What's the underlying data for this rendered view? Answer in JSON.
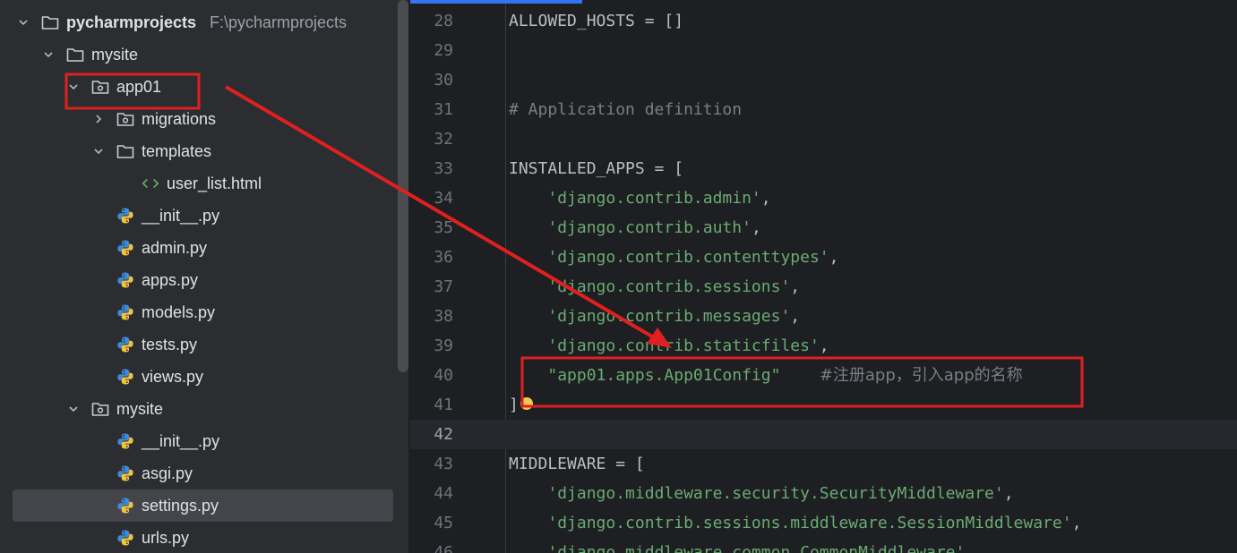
{
  "project_tree": {
    "rows": [
      {
        "label": "pycharmprojects",
        "path": "F:\\pycharmprojects",
        "type": "folder",
        "expanded": true,
        "bold": true,
        "depth": 0
      },
      {
        "label": "mysite",
        "type": "folder",
        "expanded": true,
        "depth": 1
      },
      {
        "label": "app01",
        "type": "package",
        "expanded": true,
        "depth": 2
      },
      {
        "label": "migrations",
        "type": "package",
        "expanded": false,
        "depth": 3
      },
      {
        "label": "templates",
        "type": "folder",
        "expanded": true,
        "depth": 3
      },
      {
        "label": "user_list.html",
        "type": "html",
        "depth": 4
      },
      {
        "label": "__init__.py",
        "type": "python",
        "depth": 3
      },
      {
        "label": "admin.py",
        "type": "python",
        "depth": 3
      },
      {
        "label": "apps.py",
        "type": "python",
        "depth": 3
      },
      {
        "label": "models.py",
        "type": "python",
        "depth": 3
      },
      {
        "label": "tests.py",
        "type": "python",
        "depth": 3
      },
      {
        "label": "views.py",
        "type": "python",
        "depth": 3
      },
      {
        "label": "mysite",
        "type": "package",
        "expanded": true,
        "depth": 2
      },
      {
        "label": "__init__.py",
        "type": "python",
        "depth": 3
      },
      {
        "label": "asgi.py",
        "type": "python",
        "depth": 3
      },
      {
        "label": "settings.py",
        "type": "python",
        "depth": 3,
        "selected": true
      },
      {
        "label": "urls.py",
        "type": "python",
        "depth": 3
      }
    ]
  },
  "editor": {
    "current_line": "42",
    "lines": [
      {
        "n": "28",
        "parts": [
          {
            "t": "ALLOWED_HOSTS = []",
            "c": "plain"
          }
        ]
      },
      {
        "n": "29",
        "parts": []
      },
      {
        "n": "30",
        "parts": []
      },
      {
        "n": "31",
        "parts": [
          {
            "t": "# Application definition",
            "c": "cmt"
          }
        ]
      },
      {
        "n": "32",
        "parts": []
      },
      {
        "n": "33",
        "parts": [
          {
            "t": "INSTALLED_APPS = [",
            "c": "plain"
          }
        ]
      },
      {
        "n": "34",
        "parts": [
          {
            "t": "    ",
            "c": "plain"
          },
          {
            "t": "'django.contrib.admin'",
            "c": "str"
          },
          {
            "t": ",",
            "c": "plain"
          }
        ]
      },
      {
        "n": "35",
        "parts": [
          {
            "t": "    ",
            "c": "plain"
          },
          {
            "t": "'django.contrib.auth'",
            "c": "str"
          },
          {
            "t": ",",
            "c": "plain"
          }
        ]
      },
      {
        "n": "36",
        "parts": [
          {
            "t": "    ",
            "c": "plain"
          },
          {
            "t": "'django.contrib.contenttypes'",
            "c": "str"
          },
          {
            "t": ",",
            "c": "plain"
          }
        ]
      },
      {
        "n": "37",
        "parts": [
          {
            "t": "    ",
            "c": "plain"
          },
          {
            "t": "'django.contrib.sessions'",
            "c": "str"
          },
          {
            "t": ",",
            "c": "plain"
          }
        ]
      },
      {
        "n": "38",
        "parts": [
          {
            "t": "    ",
            "c": "plain"
          },
          {
            "t": "'django.contrib.messages'",
            "c": "str"
          },
          {
            "t": ",",
            "c": "plain"
          }
        ]
      },
      {
        "n": "39",
        "parts": [
          {
            "t": "    ",
            "c": "plain"
          },
          {
            "t": "'django.contrib.staticfiles'",
            "c": "str"
          },
          {
            "t": ",",
            "c": "plain"
          }
        ]
      },
      {
        "n": "40",
        "parts": [
          {
            "t": "    ",
            "c": "plain"
          },
          {
            "t": "\"app01.apps.App01Config\"",
            "c": "str"
          },
          {
            "t": "    ",
            "c": "plain"
          },
          {
            "t": "#注册app，引入app的名称",
            "c": "zh"
          }
        ]
      },
      {
        "n": "41",
        "parts": [
          {
            "t": "]",
            "c": "plain"
          }
        ]
      },
      {
        "n": "42",
        "parts": []
      },
      {
        "n": "43",
        "parts": [
          {
            "t": "MIDDLEWARE = [",
            "c": "plain"
          }
        ]
      },
      {
        "n": "44",
        "parts": [
          {
            "t": "    ",
            "c": "plain"
          },
          {
            "t": "'django.middleware.security.SecurityMiddleware'",
            "c": "str"
          },
          {
            "t": ",",
            "c": "plain"
          }
        ]
      },
      {
        "n": "45",
        "parts": [
          {
            "t": "    ",
            "c": "plain"
          },
          {
            "t": "'django.contrib.sessions.middleware.SessionMiddleware'",
            "c": "str"
          },
          {
            "t": ",",
            "c": "plain"
          }
        ]
      },
      {
        "n": "46",
        "parts": [
          {
            "t": "    ",
            "c": "plain"
          },
          {
            "t": "'django.middleware.common.CommonMiddleware'",
            "c": "str"
          },
          {
            "t": ",",
            "c": "plain"
          }
        ]
      }
    ]
  },
  "annotation": {
    "color": "#e02020"
  },
  "colors": {
    "tree_bg": "#2b2d30",
    "editor_bg": "#1e1f22",
    "string": "#6aab73",
    "comment": "#7a7e85",
    "folder": "#c9ccd3",
    "python_blue": "#3d8bd9",
    "python_yellow": "#f0c440",
    "html": "#5fb85f"
  },
  "icons": {
    "folder": "folder-icon",
    "package": "package-folder-icon",
    "python": "python-file-icon",
    "html": "html-file-icon",
    "bulb": "intention-bulb-icon"
  }
}
